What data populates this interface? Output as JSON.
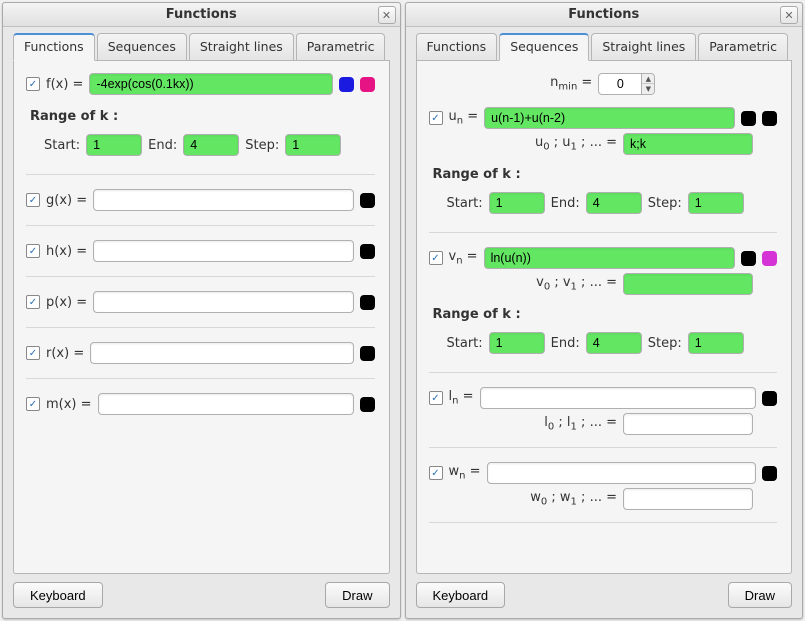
{
  "windows": [
    {
      "title": "Functions",
      "tabs": [
        "Functions",
        "Sequences",
        "Straight lines",
        "Parametric"
      ],
      "activeTab": 0,
      "buttons": {
        "keyboard": "Keyboard",
        "draw": "Draw"
      },
      "range_label": "Range of k :",
      "range_fields": {
        "start_lbl": "Start:",
        "end_lbl": "End:",
        "step_lbl": "Step:"
      },
      "functions": [
        {
          "name": "f(x) =",
          "value": "-4exp(cos(0.1kx))",
          "green": true,
          "colors": [
            "blue",
            "pink"
          ],
          "has_range": true,
          "range": {
            "start": "1",
            "end": "4",
            "step": "1"
          }
        },
        {
          "name": "g(x) =",
          "value": "",
          "green": false,
          "colors": [
            "black"
          ]
        },
        {
          "name": "h(x) =",
          "value": "",
          "green": false,
          "colors": [
            "black"
          ]
        },
        {
          "name": "p(x) =",
          "value": "",
          "green": false,
          "colors": [
            "black"
          ]
        },
        {
          "name": "r(x) =",
          "value": "",
          "green": false,
          "colors": [
            "black"
          ]
        },
        {
          "name": "m(x) =",
          "value": "",
          "green": false,
          "colors": [
            "black"
          ]
        }
      ]
    },
    {
      "title": "Functions",
      "tabs": [
        "Functions",
        "Sequences",
        "Straight lines",
        "Parametric"
      ],
      "activeTab": 1,
      "buttons": {
        "keyboard": "Keyboard",
        "draw": "Draw"
      },
      "nmin_label": "nₘᵢₙ =",
      "nmin_value": "0",
      "range_label": "Range of k :",
      "range_fields": {
        "start_lbl": "Start:",
        "end_lbl": "End:",
        "step_lbl": "Step:"
      },
      "sequences": [
        {
          "name": "uₙ =",
          "value": "u(n-1)+u(n-2)",
          "green": true,
          "colors": [
            "black",
            "black"
          ],
          "init_label": "u₀ ; u₁ ; ... =",
          "init_value": "k;k",
          "init_green": true,
          "has_range": true,
          "range": {
            "start": "1",
            "end": "4",
            "step": "1"
          }
        },
        {
          "name": "vₙ =",
          "value": "ln(u(n))",
          "green": true,
          "colors": [
            "black",
            "magenta"
          ],
          "init_label": "v₀ ; v₁ ; ... =",
          "init_value": "",
          "init_green": true,
          "has_range": true,
          "range": {
            "start": "1",
            "end": "4",
            "step": "1"
          }
        },
        {
          "name": "lₙ =",
          "value": "",
          "green": false,
          "colors": [
            "black"
          ],
          "init_label": "l₀ ; l₁ ; ... =",
          "init_value": "",
          "init_green": false
        },
        {
          "name": "wₙ =",
          "value": "",
          "green": false,
          "colors": [
            "black"
          ],
          "init_label": "w₀ ; w₁ ; ... =",
          "init_value": "",
          "init_green": false
        }
      ]
    }
  ]
}
